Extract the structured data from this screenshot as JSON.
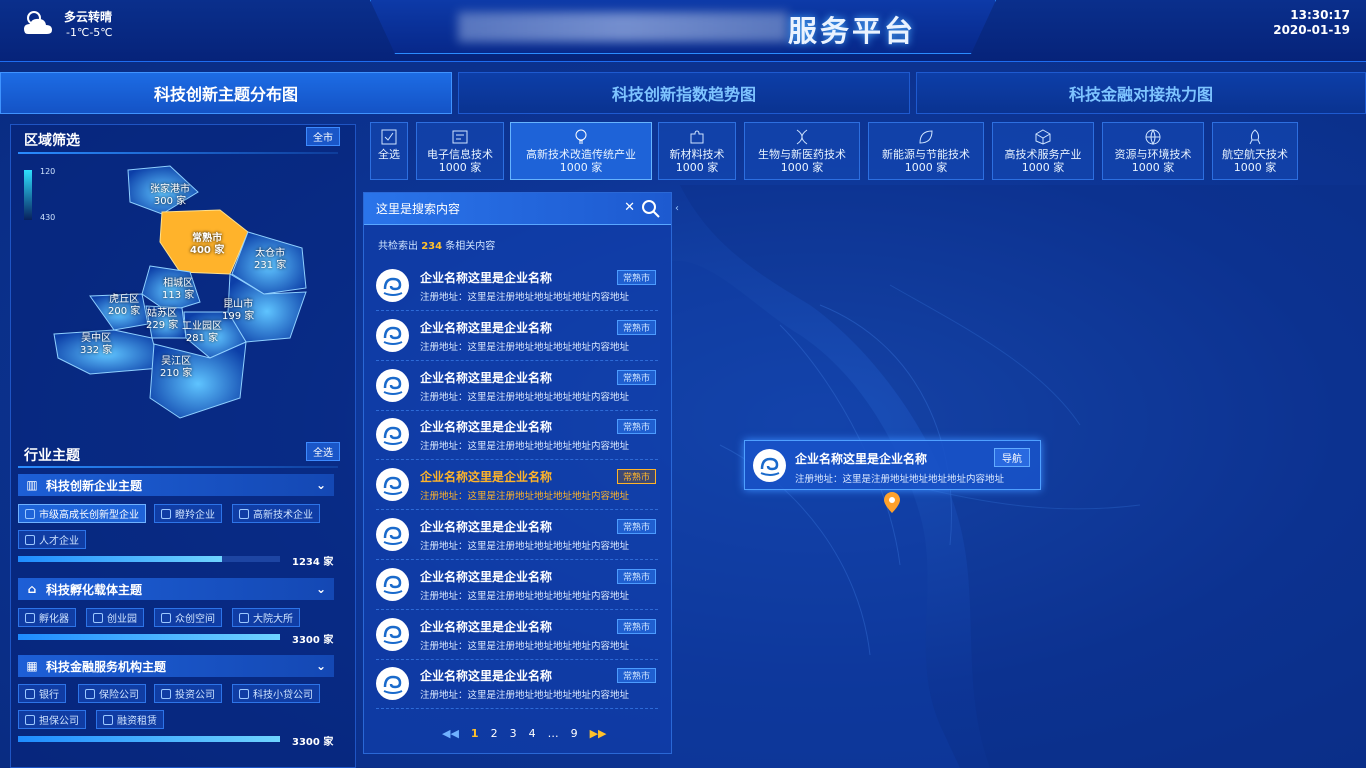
{
  "header": {
    "weather": "多云转晴",
    "temperature": "-1℃-5℃",
    "title_suffix": "服务平台",
    "time": "13:30:17",
    "date": "2020-01-19"
  },
  "tabs": [
    {
      "label": "科技创新主题分布图"
    },
    {
      "label": "科技创新指数趋势图"
    },
    {
      "label": "科技金融对接热力图"
    }
  ],
  "region": {
    "title": "区域筛选",
    "all_label": "全市",
    "legend_max": "120",
    "legend_min": "430",
    "districts": [
      {
        "name": "张家港市",
        "count": "300 家"
      },
      {
        "name": "常熟市",
        "count": "400 家"
      },
      {
        "name": "太仓市",
        "count": "231 家"
      },
      {
        "name": "相城区",
        "count": "113 家"
      },
      {
        "name": "虎丘区",
        "count": "200 家"
      },
      {
        "name": "姑苏区",
        "count": "229 家"
      },
      {
        "name": "昆山市",
        "count": "199 家"
      },
      {
        "name": "工业园区",
        "count": "281 家"
      },
      {
        "name": "吴中区",
        "count": "332 家"
      },
      {
        "name": "吴江区",
        "count": "210 家"
      }
    ]
  },
  "industry": {
    "title": "行业主题",
    "all_label": "全选",
    "groups": [
      {
        "title": "科技创新企业主题",
        "chips": [
          "市级高成长创新型企业",
          "瞪羚企业",
          "高新技术企业",
          "人才企业"
        ],
        "progress": 0.78,
        "count": "1234 家"
      },
      {
        "title": "科技孵化载体主题",
        "chips": [
          "孵化器",
          "创业园",
          "众创空间",
          "大院大所"
        ],
        "progress": 1.0,
        "count": "3300 家"
      },
      {
        "title": "科技金融服务机构主题",
        "chips": [
          "银行",
          "保险公司",
          "投资公司",
          "科技小贷公司",
          "担保公司",
          "融资租赁"
        ],
        "progress": 1.0,
        "count": "3300 家"
      }
    ]
  },
  "categories": [
    {
      "label": "全选"
    },
    {
      "label": "电子信息技术",
      "count": "1000 家"
    },
    {
      "label": "高新技术改造传统产业",
      "count": "1000 家"
    },
    {
      "label": "新材料技术",
      "count": "1000 家"
    },
    {
      "label": "生物与新医药技术",
      "count": "1000 家"
    },
    {
      "label": "新能源与节能技术",
      "count": "1000 家"
    },
    {
      "label": "高技术服务产业",
      "count": "1000 家"
    },
    {
      "label": "资源与环境技术",
      "count": "1000 家"
    },
    {
      "label": "航空航天技术",
      "count": "1000 家"
    }
  ],
  "search": {
    "value": "这里是搜索内容",
    "summary_pre": "共检索出",
    "summary_count": "234",
    "summary_post": "条相关内容"
  },
  "results": [
    {
      "name": "企业名称这里是企业名称",
      "address": "注册地址：这里是注册地址地址地址地址内容地址",
      "badge": "常熟市"
    },
    {
      "name": "企业名称这里是企业名称",
      "address": "注册地址：这里是注册地址地址地址地址内容地址",
      "badge": "常熟市"
    },
    {
      "name": "企业名称这里是企业名称",
      "address": "注册地址：这里是注册地址地址地址地址内容地址",
      "badge": "常熟市"
    },
    {
      "name": "企业名称这里是企业名称",
      "address": "注册地址：这里是注册地址地址地址地址内容地址",
      "badge": "常熟市"
    },
    {
      "name": "企业名称这里是企业名称",
      "address": "注册地址：这里是注册地址地址地址地址内容地址",
      "badge": "常熟市"
    },
    {
      "name": "企业名称这里是企业名称",
      "address": "注册地址：这里是注册地址地址地址地址内容地址",
      "badge": "常熟市"
    },
    {
      "name": "企业名称这里是企业名称",
      "address": "注册地址：这里是注册地址地址地址地址内容地址",
      "badge": "常熟市"
    },
    {
      "name": "企业名称这里是企业名称",
      "address": "注册地址：这里是注册地址地址地址地址内容地址",
      "badge": "常熟市"
    },
    {
      "name": "企业名称这里是企业名称",
      "address": "注册地址：这里是注册地址地址地址地址内容地址",
      "badge": "常熟市"
    }
  ],
  "pagination": {
    "pages": [
      "1",
      "2",
      "3",
      "4",
      "…",
      "9"
    ]
  },
  "popup": {
    "name": "企业名称这里是企业名称",
    "address": "注册地址：这里是注册地址地址地址地址内容地址",
    "nav_label": "导航"
  },
  "colors": {
    "accent": "#1e63d8",
    "highlight": "#ffb429",
    "background": "#0a2a8a"
  }
}
